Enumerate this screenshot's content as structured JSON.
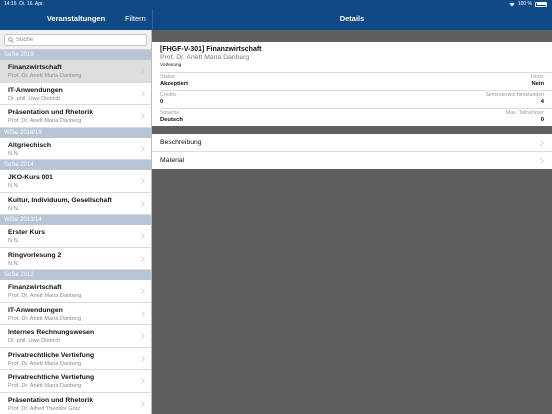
{
  "status_bar": {
    "time": "14:16",
    "date": "Di. 16. Apr.",
    "wifi_icon": "wifi-icon",
    "battery": "100 %"
  },
  "nav": {
    "left_title": "Veranstaltungen",
    "filter": "Filtern",
    "right_title": "Details"
  },
  "search": {
    "placeholder": "Suche"
  },
  "sections": [
    {
      "header": "SoSe 2019",
      "items": [
        {
          "title": "Finanzwirtschaft",
          "sub": "Prof. Dr. Anett Maria Danberg"
        },
        {
          "title": "IT-Anwendungen",
          "sub": "Dr. phil. Uwe Dietrich"
        },
        {
          "title": "Präsentation und Rhetorik",
          "sub": "Prof. Dr. Anett Maria Danberg"
        }
      ]
    },
    {
      "header": "WiSe 2018/19",
      "items": [
        {
          "title": "Altgriechisch",
          "sub": "N.N."
        }
      ]
    },
    {
      "header": "SoSe 2014",
      "items": [
        {
          "title": "JKO-Kurs 001",
          "sub": "N.N."
        },
        {
          "title": "Kultur, Individuum, Gesellschaft",
          "sub": "N.N."
        }
      ]
    },
    {
      "header": "WiSe 2013/14",
      "items": [
        {
          "title": "Erster Kurs",
          "sub": "N.N."
        },
        {
          "title": "Ringvorlesung 2",
          "sub": "N.N."
        }
      ]
    },
    {
      "header": "SoSe 2012",
      "items": [
        {
          "title": "Finanzwirtschaft",
          "sub": "Prof. Dr. Anett Maria Danberg"
        },
        {
          "title": "IT-Anwendungen",
          "sub": "Prof. Dr. Anett Maria Danberg"
        },
        {
          "title": "Internes Rechnungswesen",
          "sub": "Dr. phil. Uwe Dietrich"
        },
        {
          "title": "Privatrechtliche Vertiefung",
          "sub": "Prof. Dr. Anett Maria Danberg"
        },
        {
          "title": "Privatrechtliche Vertiefung",
          "sub": "Prof. Dr. Anett Maria Danberg"
        },
        {
          "title": "Präsentation und Rhetorik",
          "sub": "Prof. Dr. Alfred Theodor Götz"
        }
      ]
    }
  ],
  "detail": {
    "code_title": "[FHGF-V-301] Finanzwirtschaft",
    "prof": "Prof. Dr. Anett Maria Danberg",
    "type": "Vorlesung",
    "rows": [
      {
        "label_left": "Status",
        "value_left": "Akzeptiert",
        "label_right": "Hörer",
        "value_right": "Nein"
      },
      {
        "label_left": "Credits",
        "value_left": "0",
        "label_right": "Semesterwochenstunden",
        "value_right": "4"
      },
      {
        "label_left": "Sprache",
        "value_left": "Deutsch",
        "label_right": "Max. Teilnehmer",
        "value_right": "0"
      }
    ],
    "links": [
      "Beschreibung",
      "Material"
    ]
  },
  "colors": {
    "navbar": "#104a86",
    "section_header": "#b7c5d6",
    "selected_row": "#dedede",
    "background": "#5f5f5f"
  }
}
